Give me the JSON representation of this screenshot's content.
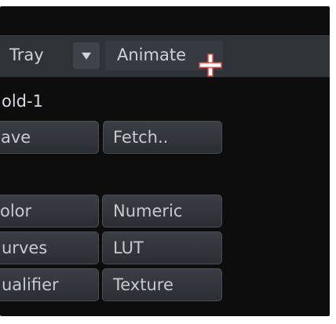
{
  "toolbar": {
    "tray_label": "Tray",
    "tray_dropdown_icon": "triangle-down-icon",
    "animate_label": "Animate"
  },
  "section": {
    "fold_label": "old-1"
  },
  "buttons": {
    "save": "ave",
    "fetch": "Fetch..",
    "color": "olor",
    "numeric": "Numeric",
    "curves": "urves",
    "lut": "LUT",
    "qualifier": "ualifier",
    "texture": "Texture"
  },
  "cursor": {
    "icon": "crosshair-cursor-icon",
    "color": "#e04848"
  },
  "colors": {
    "panel_background": "#0d0d0d",
    "toolbar_background": "#2f3237",
    "button_text": "#c6cad0"
  }
}
